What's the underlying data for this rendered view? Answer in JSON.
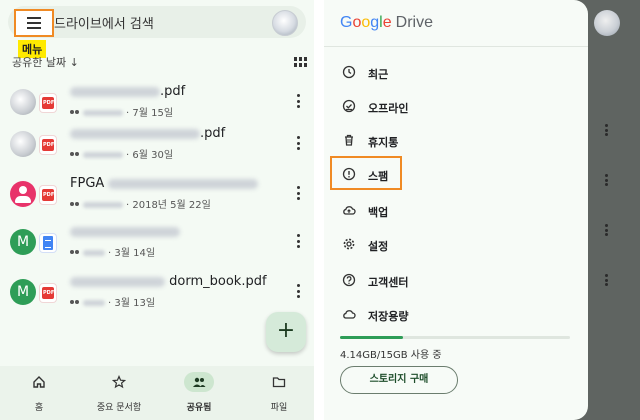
{
  "left": {
    "search_placeholder": "드라이브에서 검색",
    "menu_annotation": "메뉴",
    "sort_label": "공유한 날짜",
    "sort_arrow": "↓",
    "files": [
      {
        "name_suffix": ".pdf",
        "date": "7월 15일",
        "icon": "gray-avatar",
        "type": "pdf"
      },
      {
        "name_suffix": ".pdf",
        "date": "6월 30일",
        "icon": "gray-avatar",
        "type": "pdf"
      },
      {
        "name_prefix": "FPGA",
        "date": "2018년 5월 22일",
        "icon": "pink-person",
        "type": "pdf"
      },
      {
        "name_suffix": "",
        "date": "3월 14일",
        "icon": "green-m",
        "type": "doc",
        "initial": "M"
      },
      {
        "name_suffix": "dorm_book.pdf",
        "date": "3월 13일",
        "icon": "green-m",
        "type": "pdf",
        "initial": "M"
      }
    ],
    "fab_label": "+",
    "bottom_nav": [
      {
        "label": "홈",
        "icon": "home-icon"
      },
      {
        "label": "중요 문서함",
        "icon": "star-icon"
      },
      {
        "label": "공유됨",
        "icon": "people-icon",
        "active": true
      },
      {
        "label": "파일",
        "icon": "folder-icon"
      }
    ]
  },
  "drawer": {
    "brand_google": [
      "G",
      "o",
      "o",
      "g",
      "l",
      "e"
    ],
    "brand_product": "Drive",
    "items": [
      {
        "label": "최근",
        "icon": "clock-icon"
      },
      {
        "label": "오프라인",
        "icon": "offline-check-icon"
      },
      {
        "label": "휴지통",
        "icon": "trash-icon"
      },
      {
        "label": "스팸",
        "icon": "spam-icon"
      },
      {
        "label": "백업",
        "icon": "backup-cloud-icon"
      },
      {
        "label": "설정",
        "icon": "gear-icon"
      },
      {
        "label": "고객센터",
        "icon": "help-icon"
      },
      {
        "label": "저장용량",
        "icon": "cloud-icon"
      }
    ],
    "storage_used_fraction": 0.276,
    "storage_text": "4.14GB/15GB 사용 중",
    "buy_button": "스토리지 구매"
  },
  "colors": {
    "highlight_border": "#f08a24",
    "annotation_bg": "#ffea00",
    "accent_green": "#2e9d57"
  }
}
